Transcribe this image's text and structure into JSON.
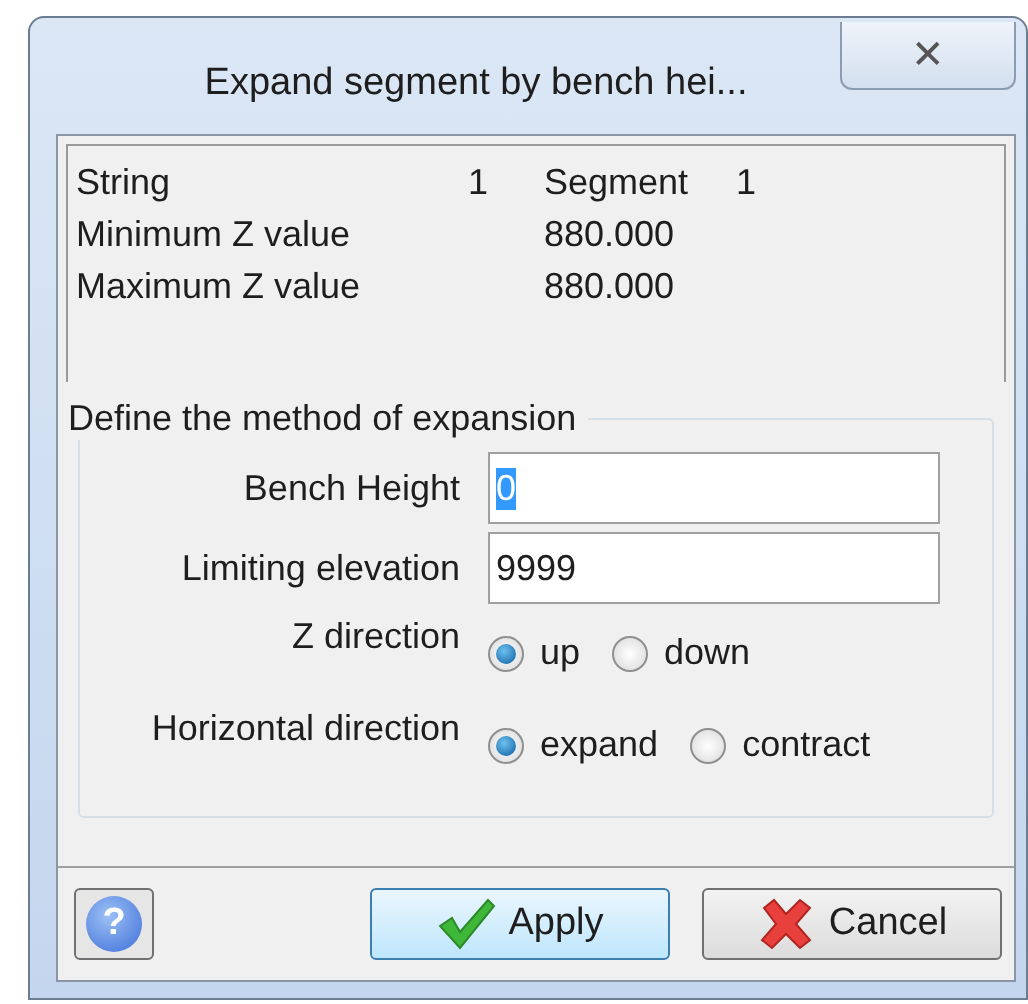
{
  "window": {
    "title": "Expand segment by bench hei...",
    "close": "✕"
  },
  "info": {
    "string_label": "String",
    "string_value": "1",
    "segment_label": "Segment",
    "segment_value": "1",
    "z_values": [
      {
        "label": "Minimum Z value",
        "value": "880.000"
      },
      {
        "label": "Maximum Z value",
        "value": "880.000"
      }
    ]
  },
  "group": {
    "title": "Define the method of expansion",
    "fields": [
      {
        "label": "Bench Height",
        "value": "0",
        "text_selected": true
      },
      {
        "label": "Limiting elevation",
        "value": "9999",
        "text_selected": false
      }
    ],
    "radio_groups": [
      {
        "label": "Z direction",
        "options": [
          {
            "label": "up",
            "selected": true
          },
          {
            "label": "down",
            "selected": false
          }
        ]
      },
      {
        "label": "Horizontal direction",
        "options": [
          {
            "label": "expand",
            "selected": true
          },
          {
            "label": "contract",
            "selected": false
          }
        ]
      }
    ]
  },
  "buttons": [
    {
      "kind": "help",
      "label": "?"
    },
    {
      "kind": "apply",
      "label": "Apply",
      "focused": true
    },
    {
      "kind": "cancel",
      "label": "Cancel",
      "focused": false
    }
  ]
}
